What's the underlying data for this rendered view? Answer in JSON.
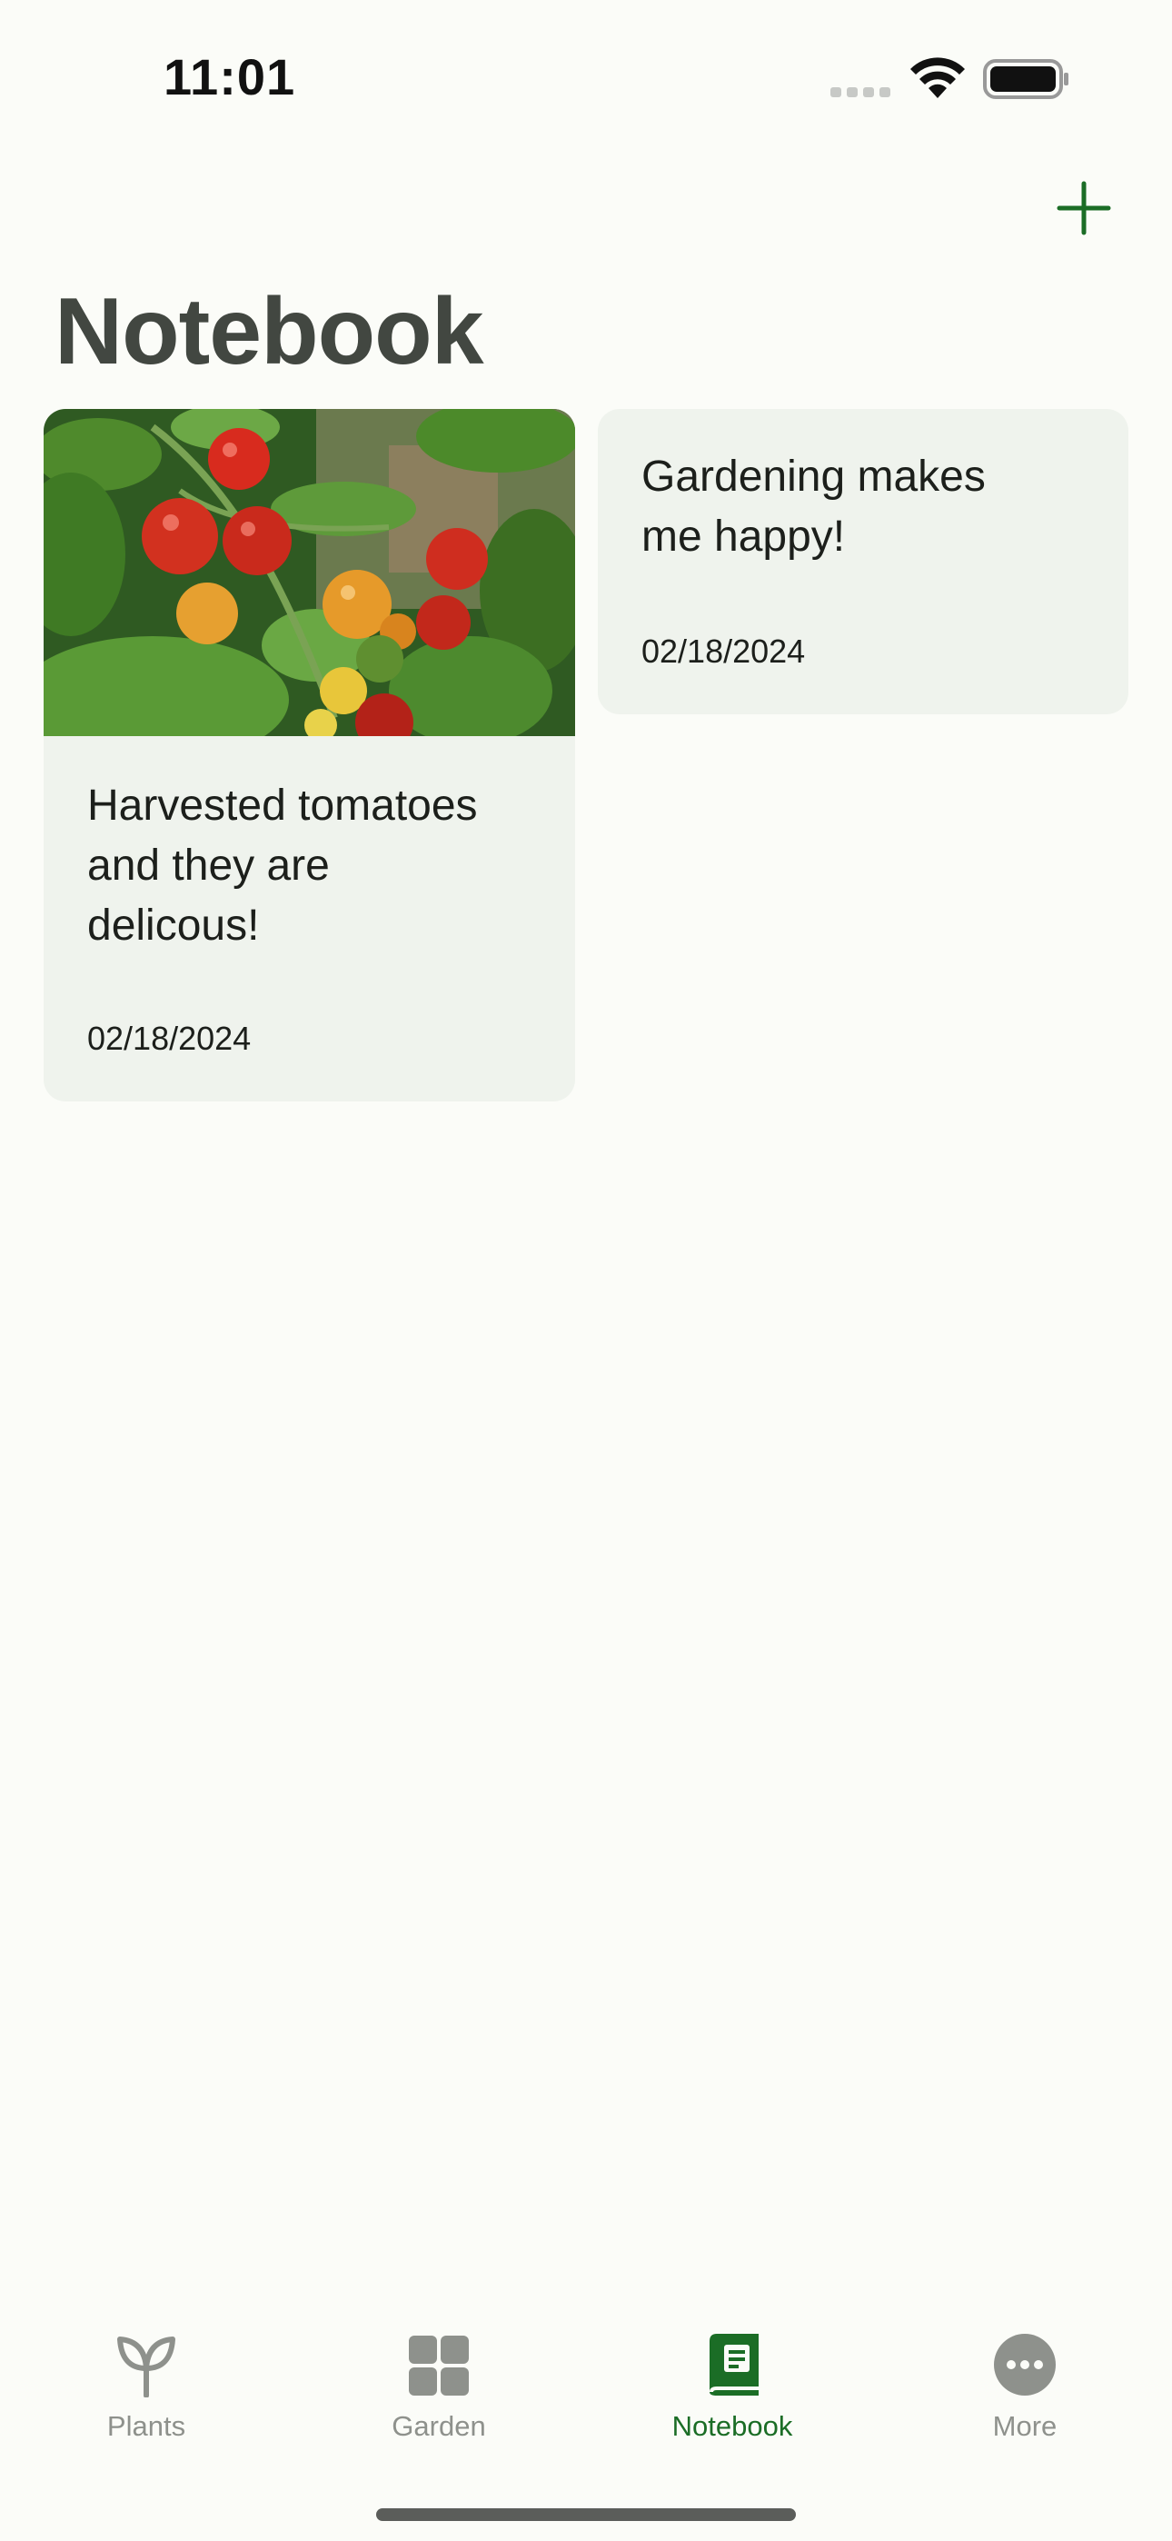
{
  "status_bar": {
    "time": "11:01"
  },
  "header": {
    "title": "Notebook",
    "add_icon": "plus-icon"
  },
  "notes": [
    {
      "text": "Harvested tomatoes\nand they are\ndelicous!",
      "date": "02/18/2024",
      "has_image": true
    },
    {
      "text": "Gardening makes\nme happy!",
      "date": "02/18/2024",
      "has_image": false
    }
  ],
  "tab_bar": {
    "tabs": [
      {
        "label": "Plants",
        "icon": "sprout-icon",
        "active": false
      },
      {
        "label": "Garden",
        "icon": "grid-icon",
        "active": false
      },
      {
        "label": "Notebook",
        "icon": "notebook-icon",
        "active": true
      },
      {
        "label": "More",
        "icon": "more-icon",
        "active": false
      }
    ]
  },
  "colors": {
    "accent": "#1b6d26",
    "card_background": "#eff3ed",
    "page_background": "#fbfcf8",
    "inactive_tab": "#8e918c",
    "title": "#424741"
  }
}
